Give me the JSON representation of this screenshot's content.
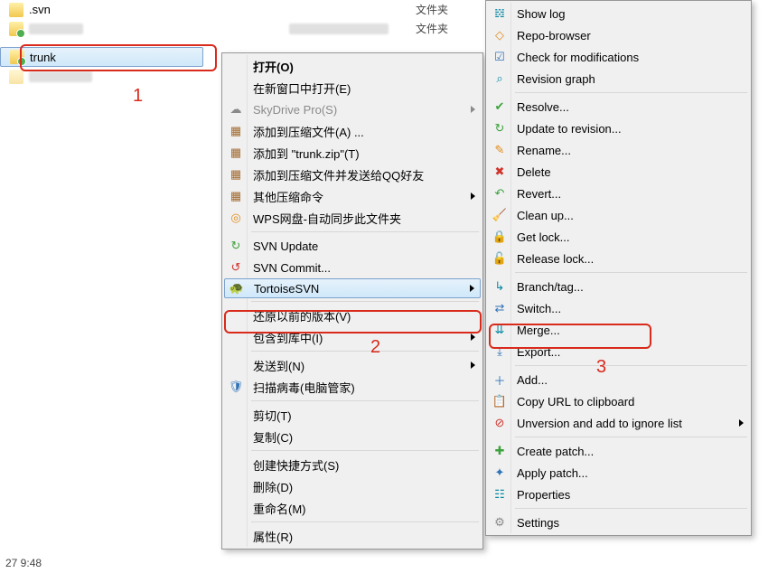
{
  "files": {
    "row0": {
      "name": ".svn",
      "type": "文件夹"
    },
    "row1": {
      "type": "文件夹"
    },
    "row2": {
      "name": "trunk"
    }
  },
  "annotations": {
    "label1": "1",
    "label2": "2",
    "label3": "3"
  },
  "menu1": {
    "open": "打开(O)",
    "open_new_window": "在新窗口中打开(E)",
    "skydrive": "SkyDrive Pro(S)",
    "add_archive": "添加到压缩文件(A) ...",
    "add_trunk_zip": "添加到 \"trunk.zip\"(T)",
    "add_archive_qq": "添加到压缩文件并发送给QQ好友",
    "other_archive": "其他压缩命令",
    "wps": "WPS网盘-自动同步此文件夹",
    "svn_update": "SVN Update",
    "svn_commit": "SVN Commit...",
    "tortoisesvn": "TortoiseSVN",
    "restore_prev": "还原以前的版本(V)",
    "include_library": "包含到库中(I)",
    "send_to": "发送到(N)",
    "scan_virus": "扫描病毒(电脑管家)",
    "cut": "剪切(T)",
    "copy": "复制(C)",
    "create_shortcut": "创建快捷方式(S)",
    "delete": "删除(D)",
    "rename": "重命名(M)",
    "properties": "属性(R)"
  },
  "menu2": {
    "show_log": "Show log",
    "repo_browser": "Repo-browser",
    "check_mods": "Check for modifications",
    "rev_graph": "Revision graph",
    "resolve": "Resolve...",
    "update_rev": "Update to revision...",
    "rename": "Rename...",
    "delete": "Delete",
    "revert": "Revert...",
    "clean_up": "Clean up...",
    "get_lock": "Get lock...",
    "release_lock": "Release lock...",
    "branch_tag": "Branch/tag...",
    "switch": "Switch...",
    "merge": "Merge...",
    "export": "Export...",
    "add": "Add...",
    "copy_url": "Copy URL to clipboard",
    "unversion": "Unversion and add to ignore list",
    "create_patch": "Create patch...",
    "apply_patch": "Apply patch...",
    "svn_properties": "Properties",
    "settings": "Settings"
  },
  "status": {
    "time": "27 9:48"
  }
}
